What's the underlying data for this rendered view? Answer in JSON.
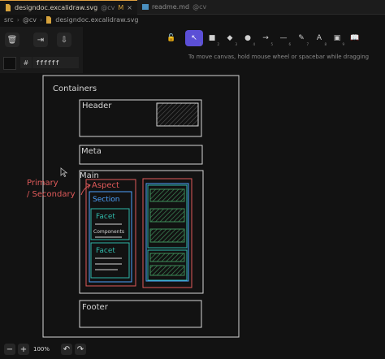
{
  "tabs": [
    {
      "title": "designdoc.excalidraw.svg",
      "subtitle": "@cv",
      "modified": "M"
    },
    {
      "title": "readme.md",
      "subtitle": "@cv"
    }
  ],
  "breadcrumb": [
    "src",
    "@cv",
    "designdoc.excalidraw.svg"
  ],
  "panel": {
    "hash": "#",
    "color_value": "ffffff"
  },
  "toolbar": {
    "tools": [
      {
        "name": "lock",
        "glyph": "🔓",
        "num": ""
      },
      {
        "name": "selection",
        "glyph": "↖",
        "num": "1"
      },
      {
        "name": "rectangle",
        "glyph": "■",
        "num": "2"
      },
      {
        "name": "diamond",
        "glyph": "◆",
        "num": "3"
      },
      {
        "name": "ellipse",
        "glyph": "●",
        "num": "4"
      },
      {
        "name": "arrow",
        "glyph": "→",
        "num": "5"
      },
      {
        "name": "line",
        "glyph": "—",
        "num": "6"
      },
      {
        "name": "draw",
        "glyph": "✎",
        "num": "7"
      },
      {
        "name": "text",
        "glyph": "A",
        "num": "8"
      },
      {
        "name": "image",
        "glyph": "▣",
        "num": "9"
      },
      {
        "name": "library",
        "glyph": "📖",
        "num": ""
      }
    ],
    "hint": "To move canvas, hold mouse wheel or spacebar while dragging"
  },
  "diagram": {
    "containers": "Containers",
    "header": "Header",
    "meta": "Meta",
    "main": "Main",
    "aspect": "Aspect",
    "section": "Section",
    "facet1": "Facet",
    "components": "Components",
    "facet2": "Facet",
    "footer": "Footer",
    "annotation_line1": "Primary",
    "annotation_line2": "/ Secondary"
  },
  "bottom": {
    "minus": "−",
    "plus": "+",
    "zoom": "100%",
    "undo": "↶",
    "redo": "↷"
  },
  "colors": {
    "accent": "#5b4fd6",
    "red": "#e05a5a",
    "blue": "#4da3ff",
    "teal": "#2fb7a8",
    "green": "#3f8f5a"
  }
}
